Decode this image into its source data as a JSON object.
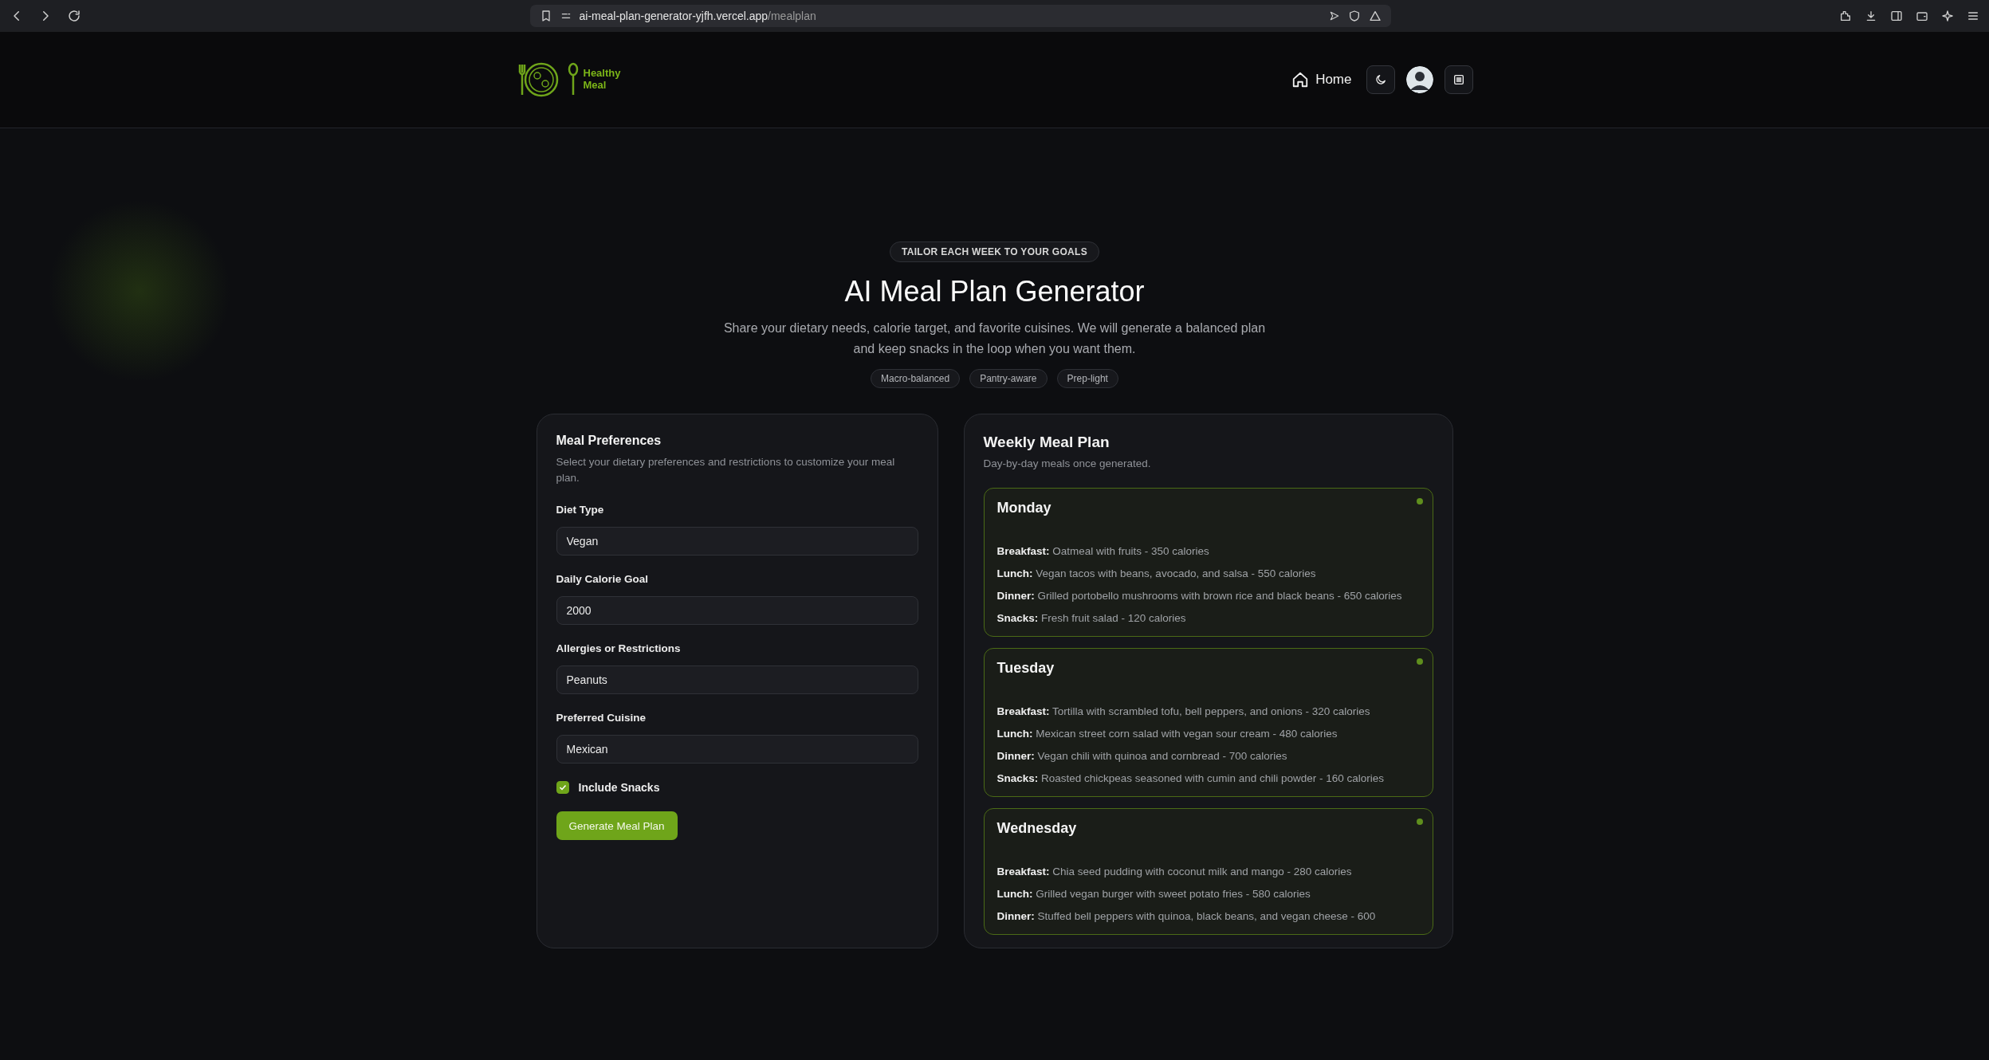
{
  "browser": {
    "url_host": "ai-meal-plan-generator-yjfh.vercel.app",
    "url_path": "/mealplan"
  },
  "header": {
    "logo_text": [
      "Healthy",
      "Meal"
    ],
    "nav_home": "Home"
  },
  "hero": {
    "eyebrow": "TAILOR EACH WEEK TO YOUR GOALS",
    "title": "AI Meal Plan Generator",
    "description": "Share your dietary needs, calorie target, and favorite cuisines. We will generate a balanced plan and keep snacks in the loop when you want them.",
    "tags": [
      "Macro-balanced",
      "Pantry-aware",
      "Prep-light"
    ]
  },
  "preferences": {
    "title": "Meal Preferences",
    "subtitle": "Select your dietary preferences and restrictions to customize your meal plan.",
    "fields": [
      {
        "label": "Diet Type",
        "value": "Vegan"
      },
      {
        "label": "Daily Calorie Goal",
        "value": "2000"
      },
      {
        "label": "Allergies or Restrictions",
        "value": "Peanuts"
      },
      {
        "label": "Preferred Cuisine",
        "value": "Mexican"
      }
    ],
    "include_snacks": {
      "label": "Include Snacks",
      "checked": true
    },
    "button": "Generate Meal Plan"
  },
  "plan": {
    "title": "Weekly Meal Plan",
    "subtitle": "Day-by-day meals once generated.",
    "days": [
      {
        "day": "Monday",
        "meals": [
          {
            "label": "Breakfast:",
            "text": "Oatmeal with fruits - 350 calories"
          },
          {
            "label": "Lunch:",
            "text": "Vegan tacos with beans, avocado, and salsa - 550 calories"
          },
          {
            "label": "Dinner:",
            "text": "Grilled portobello mushrooms with brown rice and black beans - 650 calories"
          },
          {
            "label": "Snacks:",
            "text": "Fresh fruit salad - 120 calories"
          }
        ]
      },
      {
        "day": "Tuesday",
        "meals": [
          {
            "label": "Breakfast:",
            "text": "Tortilla with scrambled tofu, bell peppers, and onions - 320 calories"
          },
          {
            "label": "Lunch:",
            "text": "Mexican street corn salad with vegan sour cream - 480 calories"
          },
          {
            "label": "Dinner:",
            "text": "Vegan chili with quinoa and cornbread - 700 calories"
          },
          {
            "label": "Snacks:",
            "text": "Roasted chickpeas seasoned with cumin and chili powder - 160 calories"
          }
        ]
      },
      {
        "day": "Wednesday",
        "meals": [
          {
            "label": "Breakfast:",
            "text": "Chia seed pudding with coconut milk and mango - 280 calories"
          },
          {
            "label": "Lunch:",
            "text": "Grilled vegan burger with sweet potato fries - 580 calories"
          },
          {
            "label": "Dinner:",
            "text": "Stuffed bell peppers with quinoa, black beans, and vegan cheese - 600"
          }
        ]
      }
    ]
  }
}
